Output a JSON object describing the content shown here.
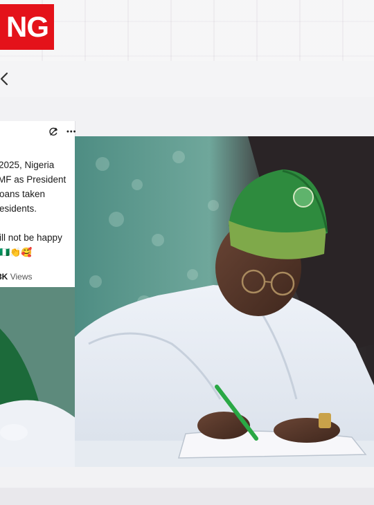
{
  "badge": {
    "text": "NG"
  },
  "tweet": {
    "lines": [
      "2025, Nigeria",
      "MF as President",
      "oans taken",
      "esidents.",
      "",
      "ill not be happy"
    ],
    "emojis": "🇳🇬👏🥰",
    "views_count": "3K",
    "views_label": "Views"
  },
  "icons": {
    "back": "chevron-left-icon",
    "refresh": "refresh-icon",
    "more": "more-icon"
  },
  "colors": {
    "badge_red": "#e4121a",
    "cap_green": "#2e8b3e",
    "robe_white": "#f3f5f8"
  }
}
